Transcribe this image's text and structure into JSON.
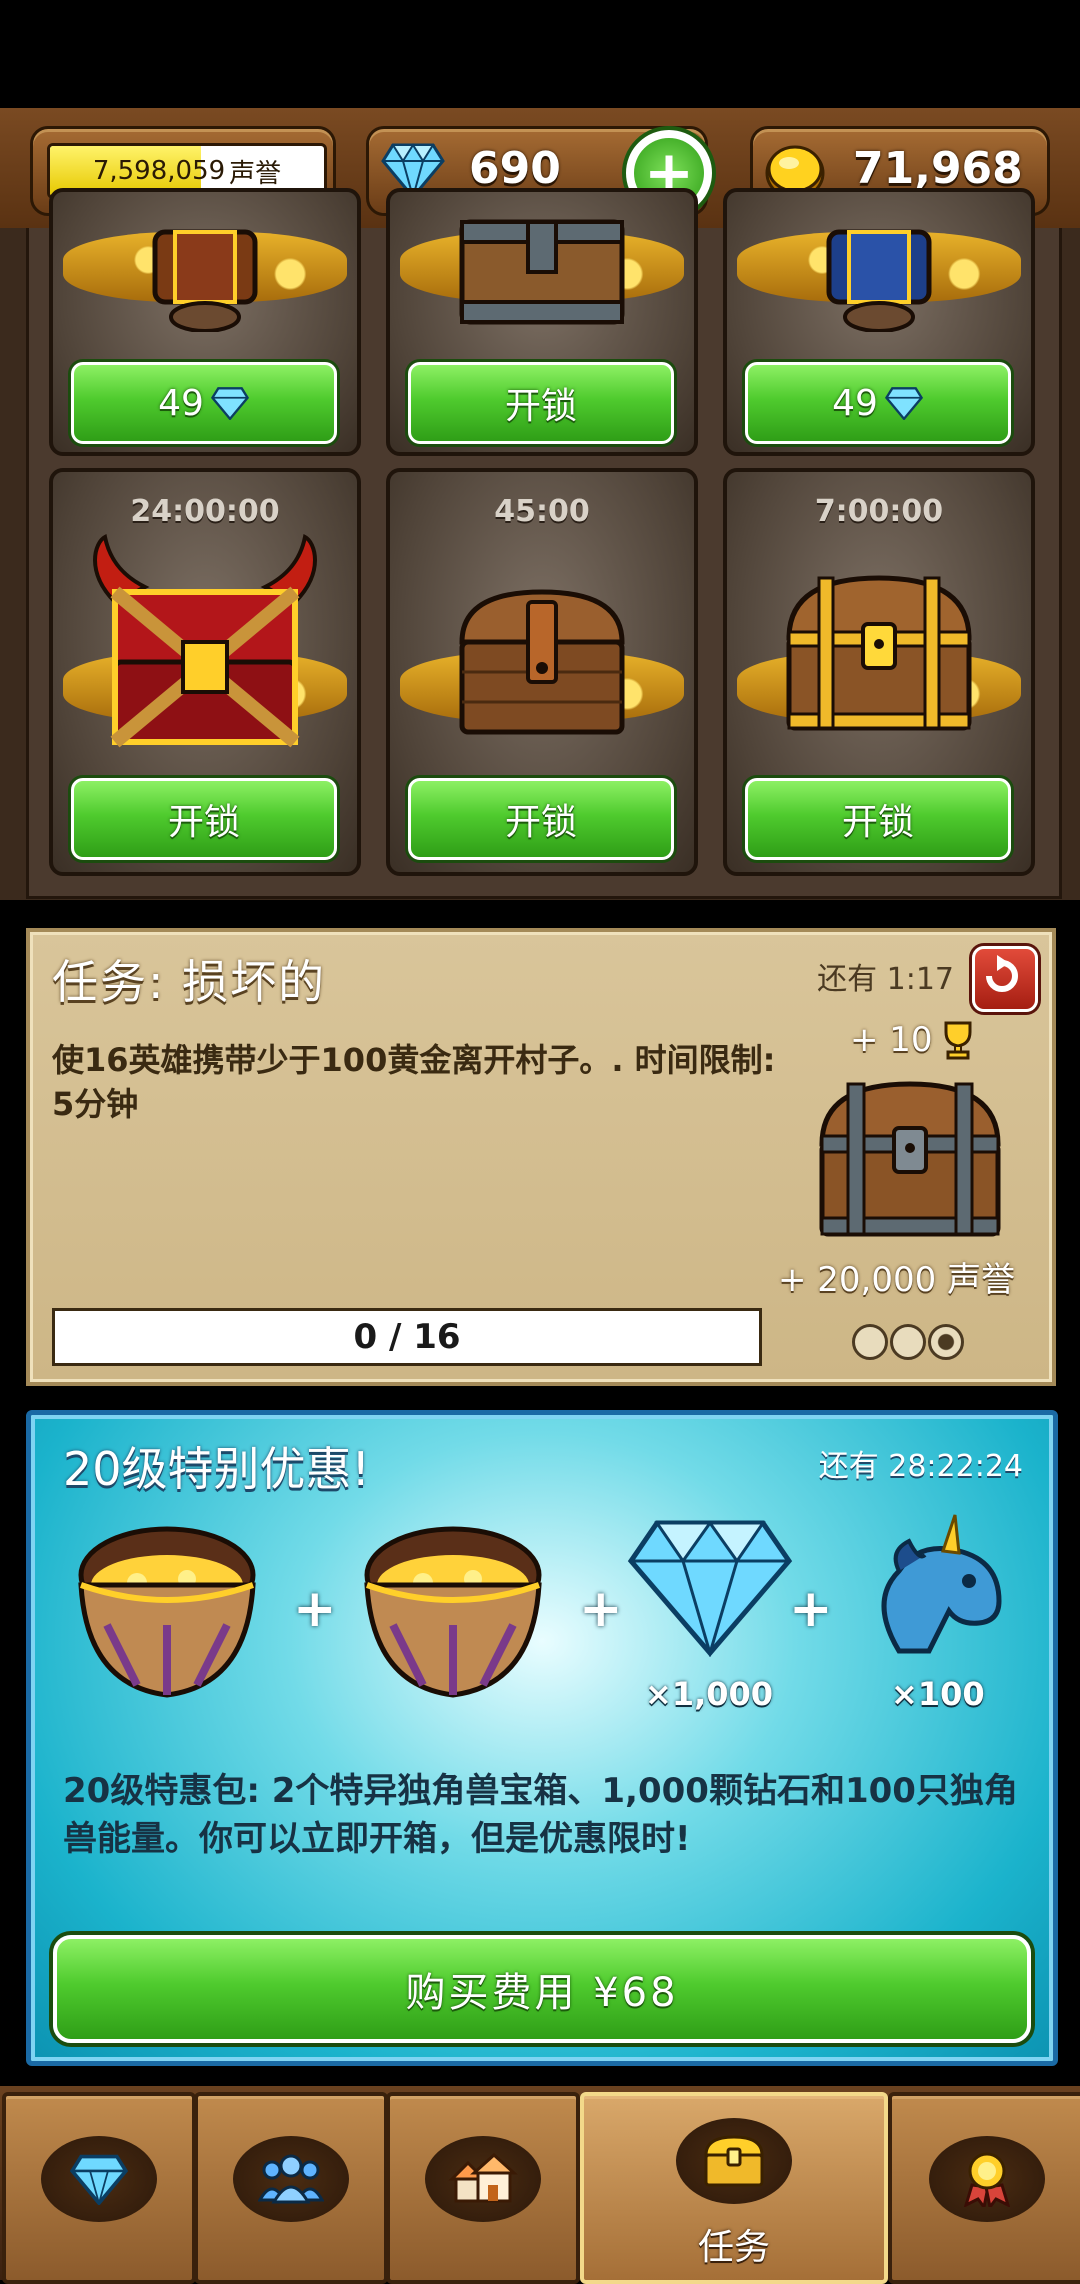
{
  "topbar": {
    "fame_value": "7,598,059",
    "fame_unit": "声誉",
    "fame_progress": 0.55,
    "gems": "690",
    "gold": "71,968"
  },
  "chest_slots": {
    "row1": [
      {
        "button": "49",
        "button_icon": "diamond-icon"
      },
      {
        "button": "开锁"
      },
      {
        "button": "49",
        "button_icon": "diamond-icon"
      }
    ],
    "row2": [
      {
        "timer": "24:00:00",
        "button": "开锁",
        "chest": "horned-red-chest"
      },
      {
        "timer": "45:00",
        "button": "开锁",
        "chest": "wooden-chest"
      },
      {
        "timer": "7:00:00",
        "button": "开锁",
        "chest": "golden-chest"
      }
    ]
  },
  "quest": {
    "title": "任务: 损坏的",
    "time_left": "还有 1:17",
    "description": "使16英雄携带少于100黄金离开村子。. 时间限制: 5分钟",
    "reward_trophies": "+ 10",
    "reward_fame": "+ 20,000 声誉",
    "progress": "0 / 16",
    "stage_dots": 3
  },
  "offer": {
    "title": "20级特别优惠!",
    "time_left": "还有 28:22:24",
    "diamond_mult": "×1,000",
    "unicorn_mult": "×100",
    "description": "20级特惠包: 2个特异独角兽宝箱、1,000颗钻石和100只独角兽能量。你可以立即开箱，但是优惠限时!",
    "buy_label": "购买费用 ¥68"
  },
  "nav": {
    "items": [
      {
        "icon": "diamond-icon"
      },
      {
        "icon": "heroes-icon"
      },
      {
        "icon": "village-icon"
      },
      {
        "icon": "chest-icon",
        "label": "任务",
        "active": true
      },
      {
        "icon": "medal-icon"
      }
    ]
  },
  "colors": {
    "button_green": "#4fcb2e",
    "offer_cyan": "#1bb3cc",
    "parchment": "#d9c59a",
    "wood": "#7a4a22"
  }
}
